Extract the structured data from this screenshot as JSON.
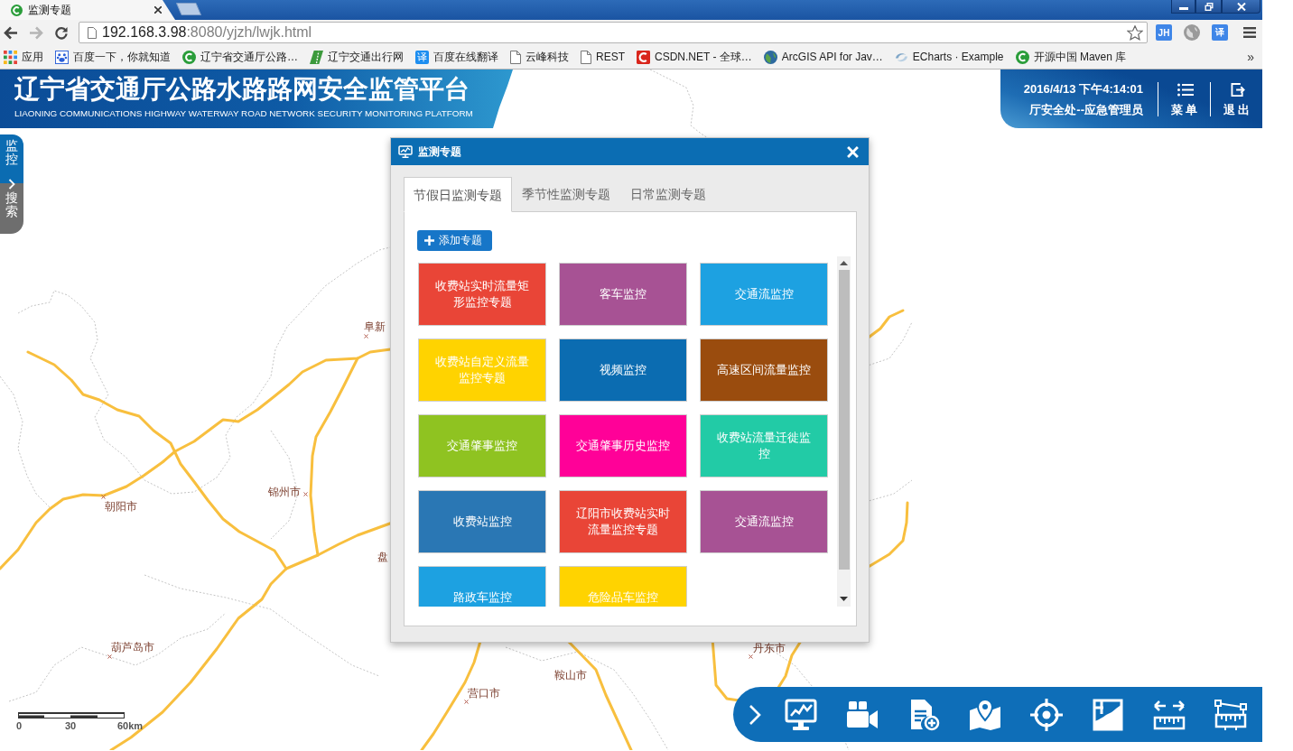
{
  "browser": {
    "tab": {
      "title": "监测专题"
    },
    "nav": [
      {
        "kind": "back",
        "disabled": false
      },
      {
        "kind": "forward",
        "disabled": true
      },
      {
        "kind": "reload",
        "disabled": false
      }
    ],
    "address": {
      "host": "192.168.3.98",
      "rest": ":8080/yjzh/lwjk.html"
    },
    "extensions": [
      {
        "kind": "badge",
        "text": "JH"
      },
      {
        "kind": "globe"
      },
      {
        "kind": "badge",
        "text": "译"
      }
    ],
    "bookmarks": [
      {
        "kind": "apps",
        "label": "应用"
      },
      {
        "kind": "paw",
        "label": "百度一下，你就知道"
      },
      {
        "kind": "green-c",
        "label": "辽宁省交通厅公路…"
      },
      {
        "kind": "road",
        "label": "辽宁交通出行网"
      },
      {
        "kind": "badge",
        "badge": "译",
        "label": "百度在线翻译"
      },
      {
        "kind": "page",
        "label": "云峰科技"
      },
      {
        "kind": "page",
        "label": "REST"
      },
      {
        "kind": "red-c",
        "label": "CSDN.NET - 全球…"
      },
      {
        "kind": "globe",
        "label": "ArcGIS API for Jav…"
      },
      {
        "kind": "echarts",
        "label": "ECharts · Example"
      },
      {
        "kind": "green-c",
        "label": "开源中国 Maven 库"
      }
    ],
    "bookmarks_more": "»"
  },
  "header": {
    "title": "辽宁省交通厅公路水路路网安全监管平台",
    "subtitle": "LIAONING COMMUNICATIONS HIGHWAY WATERWAY ROAD NETWORK SECURITY MONITORING PLATFORM",
    "datetime": "2016/4/13 下午4:14:01",
    "user": "厅安全处--应急管理员",
    "actions": [
      {
        "kind": "menu",
        "label": "菜单"
      },
      {
        "kind": "logout",
        "label": "退出"
      }
    ]
  },
  "side_tabs": [
    {
      "label": "监控",
      "selected": true
    },
    {
      "label": "搜索",
      "selected": false
    }
  ],
  "map": {
    "labels": [
      "阜新",
      "朝阳市",
      "锦州市",
      "盘",
      "葫芦岛市",
      "营口市",
      "鞍山市",
      "丹东市"
    ],
    "scale": [
      "0",
      "30",
      "60km"
    ]
  },
  "dialog": {
    "title": "监测专题",
    "tabs": [
      {
        "label": "节假日监测专题",
        "selected": true
      },
      {
        "label": "季节性监测专题",
        "selected": false
      },
      {
        "label": "日常监测专题",
        "selected": false
      }
    ],
    "add_button": "添加专题",
    "tiles": [
      {
        "label": "收费站实时流量矩形监控专题",
        "color": "#e94537"
      },
      {
        "label": "客车监控",
        "color": "#a75294"
      },
      {
        "label": "交通流监控",
        "color": "#1da1e1"
      },
      {
        "label": "收费站自定义流量监控专题",
        "color": "#ffd300"
      },
      {
        "label": "视频监控",
        "color": "#0b6cb1"
      },
      {
        "label": "高速区间流量监控",
        "color": "#9a4c0e"
      },
      {
        "label": "交通肇事监控",
        "color": "#8fc321"
      },
      {
        "label": "交通肇事历史监控",
        "color": "#ff0198"
      },
      {
        "label": "收费站流量迁徙监控",
        "color": "#22cba6"
      },
      {
        "label": "收费站监控",
        "color": "#2a77b4"
      },
      {
        "label": "辽阳市收费站实时流量监控专题",
        "color": "#e94537"
      },
      {
        "label": "交通流监控",
        "color": "#a75294"
      },
      {
        "label": "路政车监控",
        "color": "#1da1e1"
      },
      {
        "label": "危险品车监控",
        "color": "#ffd300"
      }
    ]
  }
}
